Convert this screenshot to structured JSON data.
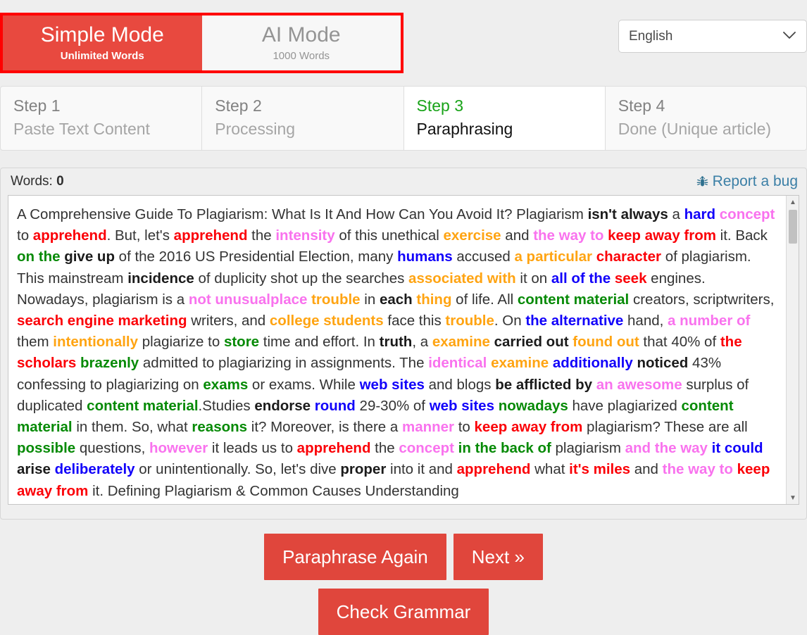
{
  "mode_switch": {
    "highlight_color": "#ff0000",
    "active_color": "#e8493f",
    "options": [
      {
        "title": "Simple Mode",
        "subtitle": "Unlimited Words",
        "active": true
      },
      {
        "title": "AI Mode",
        "subtitle": "1000 Words",
        "active": false
      }
    ]
  },
  "language": {
    "selected": "English",
    "options": [
      "English"
    ],
    "chevron_icon": "chevron-down-icon"
  },
  "steps": [
    {
      "number": "Step 1",
      "label": "Paste Text Content",
      "current": false
    },
    {
      "number": "Step 2",
      "label": "Processing",
      "current": false
    },
    {
      "number": "Step 3",
      "label": "Paraphrasing",
      "current": true
    },
    {
      "number": "Step 4",
      "label": "Done (Unique article)",
      "current": false
    }
  ],
  "editor": {
    "words_label": "Words:",
    "words_count": "0",
    "report_bug_label": "Report a bug",
    "bug_icon": "bug-icon",
    "scroll_up_icon": "triangle-up-icon",
    "scroll_down_icon": "triangle-down-icon",
    "colors": {
      "red": "#fb0007",
      "pink": "#f972ee",
      "orange": "#ffa412",
      "blue": "#1100fa",
      "green": "#068a06",
      "black": "#1b1b1b"
    },
    "content_tokens": [
      {
        "t": "A Comprehensive Guide To Plagiarism: What Is It And How Can You Avoid It? Plagiarism ",
        "s": "plain"
      },
      {
        "t": "isn't always",
        "s": "black"
      },
      {
        "t": " a ",
        "s": "plain"
      },
      {
        "t": "hard concept",
        "s": "blue-pink"
      },
      {
        "t": " to ",
        "s": "plain"
      },
      {
        "t": "apprehend",
        "s": "red"
      },
      {
        "t": ". But, let's ",
        "s": "plain"
      },
      {
        "t": "apprehend",
        "s": "red"
      },
      {
        "t": " the ",
        "s": "plain"
      },
      {
        "t": "intensity",
        "s": "pink"
      },
      {
        "t": " of this unethical ",
        "s": "plain"
      },
      {
        "t": "exercise",
        "s": "orange"
      },
      {
        "t": " and ",
        "s": "plain"
      },
      {
        "t": "the way to",
        "s": "pink"
      },
      {
        "t": " ",
        "s": "plain"
      },
      {
        "t": "keep away from",
        "s": "red"
      },
      {
        "t": " it. Back ",
        "s": "plain"
      },
      {
        "t": "on the",
        "s": "green"
      },
      {
        "t": " ",
        "s": "plain"
      },
      {
        "t": "give up",
        "s": "black"
      },
      {
        "t": " of the 2016 US Presidential Election, many ",
        "s": "plain"
      },
      {
        "t": "humans",
        "s": "blue"
      },
      {
        "t": " accused ",
        "s": "plain"
      },
      {
        "t": "a particular",
        "s": "orange"
      },
      {
        "t": " ",
        "s": "plain"
      },
      {
        "t": "character",
        "s": "red"
      },
      {
        "t": " of plagiarism. This mainstream ",
        "s": "plain"
      },
      {
        "t": "incidence",
        "s": "black"
      },
      {
        "t": " of duplicity shot up the searches ",
        "s": "plain"
      },
      {
        "t": "associated with",
        "s": "orange"
      },
      {
        "t": " it on ",
        "s": "plain"
      },
      {
        "t": "all of the",
        "s": "blue"
      },
      {
        "t": " ",
        "s": "plain"
      },
      {
        "t": "seek",
        "s": "red"
      },
      {
        "t": " engines. Nowadays, plagiarism is a ",
        "s": "plain"
      },
      {
        "t": "not unusualplace",
        "s": "pink"
      },
      {
        "t": " ",
        "s": "plain"
      },
      {
        "t": "trouble",
        "s": "orange"
      },
      {
        "t": " in ",
        "s": "plain"
      },
      {
        "t": "each",
        "s": "black"
      },
      {
        "t": " ",
        "s": "plain"
      },
      {
        "t": "thing",
        "s": "orange"
      },
      {
        "t": " of life. All ",
        "s": "plain"
      },
      {
        "t": "content material",
        "s": "green"
      },
      {
        "t": " creators, scriptwriters, ",
        "s": "plain"
      },
      {
        "t": "search engine marketing",
        "s": "red"
      },
      {
        "t": " writers, and ",
        "s": "plain"
      },
      {
        "t": "college students",
        "s": "orange"
      },
      {
        "t": " face this ",
        "s": "plain"
      },
      {
        "t": "trouble",
        "s": "orange"
      },
      {
        "t": ". On ",
        "s": "plain"
      },
      {
        "t": "the alternative",
        "s": "blue"
      },
      {
        "t": " hand, ",
        "s": "plain"
      },
      {
        "t": "a number of",
        "s": "pink"
      },
      {
        "t": " them ",
        "s": "plain"
      },
      {
        "t": "intentionally",
        "s": "orange"
      },
      {
        "t": " plagiarize to ",
        "s": "plain"
      },
      {
        "t": "store",
        "s": "green"
      },
      {
        "t": " time and effort. In ",
        "s": "plain"
      },
      {
        "t": "truth",
        "s": "black"
      },
      {
        "t": ", a ",
        "s": "plain"
      },
      {
        "t": "examine",
        "s": "orange"
      },
      {
        "t": " ",
        "s": "plain"
      },
      {
        "t": "carried out",
        "s": "black"
      },
      {
        "t": " ",
        "s": "plain"
      },
      {
        "t": "found out",
        "s": "orange"
      },
      {
        "t": " that 40% of ",
        "s": "plain"
      },
      {
        "t": "the scholars",
        "s": "red"
      },
      {
        "t": " ",
        "s": "plain"
      },
      {
        "t": "brazenly",
        "s": "green"
      },
      {
        "t": " admitted to plagiarizing in assignments. The ",
        "s": "plain"
      },
      {
        "t": "identical",
        "s": "pink"
      },
      {
        "t": " ",
        "s": "plain"
      },
      {
        "t": "examine",
        "s": "orange"
      },
      {
        "t": " ",
        "s": "plain"
      },
      {
        "t": "additionally",
        "s": "blue"
      },
      {
        "t": " ",
        "s": "plain"
      },
      {
        "t": "noticed",
        "s": "black"
      },
      {
        "t": " 43% confessing to plagiarizing on ",
        "s": "plain"
      },
      {
        "t": "exams",
        "s": "green"
      },
      {
        "t": " or exams. While ",
        "s": "plain"
      },
      {
        "t": "web sites",
        "s": "blue"
      },
      {
        "t": " and blogs ",
        "s": "plain"
      },
      {
        "t": "be afflicted by",
        "s": "black"
      },
      {
        "t": " ",
        "s": "plain"
      },
      {
        "t": "an awesome",
        "s": "pink"
      },
      {
        "t": " surplus of duplicated ",
        "s": "plain"
      },
      {
        "t": "content material",
        "s": "green"
      },
      {
        "t": ".Studies ",
        "s": "plain"
      },
      {
        "t": "endorse",
        "s": "black"
      },
      {
        "t": " ",
        "s": "plain"
      },
      {
        "t": "round",
        "s": "blue"
      },
      {
        "t": " 29-30% of ",
        "s": "plain"
      },
      {
        "t": "web sites",
        "s": "blue"
      },
      {
        "t": " ",
        "s": "plain"
      },
      {
        "t": "nowadays",
        "s": "green"
      },
      {
        "t": " have plagiarized ",
        "s": "plain"
      },
      {
        "t": "content material",
        "s": "green"
      },
      {
        "t": " in them. So, what ",
        "s": "plain"
      },
      {
        "t": "reasons",
        "s": "green"
      },
      {
        "t": " it? Moreover, is there a ",
        "s": "plain"
      },
      {
        "t": "manner",
        "s": "pink"
      },
      {
        "t": " to ",
        "s": "plain"
      },
      {
        "t": "keep away from",
        "s": "red"
      },
      {
        "t": " plagiarism? These are all ",
        "s": "plain"
      },
      {
        "t": "possible",
        "s": "green"
      },
      {
        "t": " questions, ",
        "s": "plain"
      },
      {
        "t": "however",
        "s": "pink"
      },
      {
        "t": " it leads us to ",
        "s": "plain"
      },
      {
        "t": "apprehend",
        "s": "red"
      },
      {
        "t": " the ",
        "s": "plain"
      },
      {
        "t": "concept",
        "s": "pink"
      },
      {
        "t": " ",
        "s": "plain"
      },
      {
        "t": "in the back of",
        "s": "green"
      },
      {
        "t": " plagiarism ",
        "s": "plain"
      },
      {
        "t": "and the way",
        "s": "pink"
      },
      {
        "t": " ",
        "s": "plain"
      },
      {
        "t": "it could",
        "s": "blue"
      },
      {
        "t": " ",
        "s": "plain"
      },
      {
        "t": "arise",
        "s": "black"
      },
      {
        "t": " ",
        "s": "plain"
      },
      {
        "t": "deliberately",
        "s": "blue"
      },
      {
        "t": " or unintentionally. So, let's dive ",
        "s": "plain"
      },
      {
        "t": "proper",
        "s": "black"
      },
      {
        "t": " into it and ",
        "s": "plain"
      },
      {
        "t": "apprehend",
        "s": "red"
      },
      {
        "t": " what ",
        "s": "plain"
      },
      {
        "t": "it's miles",
        "s": "red"
      },
      {
        "t": " and ",
        "s": "plain"
      },
      {
        "t": "the way to",
        "s": "pink"
      },
      {
        "t": " ",
        "s": "plain"
      },
      {
        "t": "keep away from",
        "s": "red"
      },
      {
        "t": " it. Defining Plagiarism & Common Causes Understanding",
        "s": "plain"
      }
    ]
  },
  "actions": {
    "paraphrase_again": "Paraphrase Again",
    "next": "Next »",
    "check_grammar": "Check Grammar",
    "button_color": "#e0463c"
  }
}
